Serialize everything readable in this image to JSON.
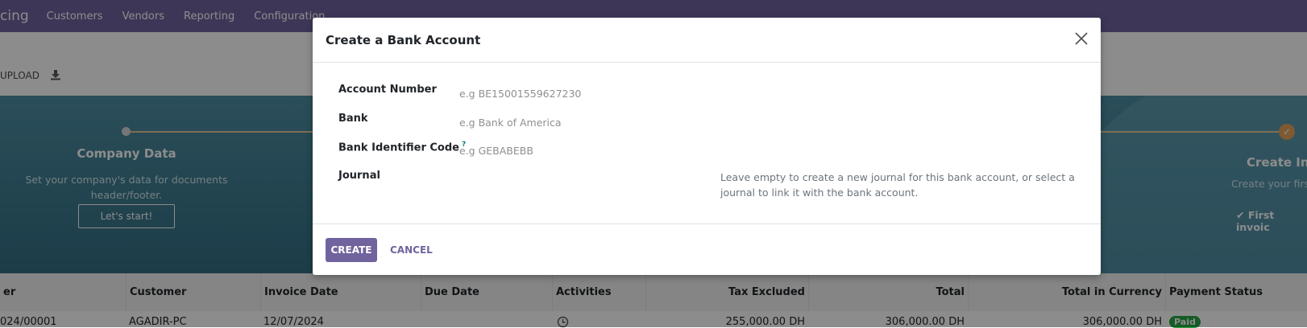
{
  "topnav": {
    "app_name": "cing",
    "menu": [
      "Customers",
      "Vendors",
      "Reporting",
      "Configuration"
    ]
  },
  "control_panel": {
    "upload_label": "UPLOAD",
    "download_icon": "download-icon"
  },
  "onboarding": {
    "step_left": {
      "title": "Company Data",
      "description_line1": "Set your company's data for documents",
      "description_line2": "header/footer.",
      "button": "Let's start!"
    },
    "step_right": {
      "title": "Create Invo",
      "description": "Create your first",
      "done_label": "First invoic",
      "done_icon": "check-icon"
    }
  },
  "modal": {
    "title": "Create a Bank Account",
    "fields": {
      "account_number": {
        "label": "Account Number",
        "placeholder": "e.g BE15001559627230"
      },
      "bank": {
        "label": "Bank",
        "placeholder": "e.g Bank of America"
      },
      "bic": {
        "label": "Bank Identifier Code",
        "help": "?",
        "placeholder": "e.g GEBABEBB"
      },
      "journal": {
        "label": "Journal",
        "hint": "Leave empty to create a new journal for this bank account, or select a journal to link it with the bank account."
      }
    },
    "buttons": {
      "create": "CREATE",
      "cancel": "CANCEL"
    }
  },
  "table": {
    "columns": [
      "er",
      "Customer",
      "Invoice Date",
      "Due Date",
      "Activities",
      "Tax Excluded",
      "Total",
      "Total in Currency",
      "Payment Status"
    ],
    "row": {
      "number": "024/00001",
      "customer": "AGADIR-PC",
      "invoice_date": "12/07/2024",
      "due_date": "",
      "activity_icon": "clock-icon",
      "tax_excluded": "255,000.00 DH",
      "total": "306,000.00 DH",
      "total_currency": "306,000.00 DH",
      "payment_status": "Paid"
    }
  },
  "colors": {
    "brand": "#71639e",
    "onboarding": "#3d7d92",
    "paid": "#28a745"
  }
}
